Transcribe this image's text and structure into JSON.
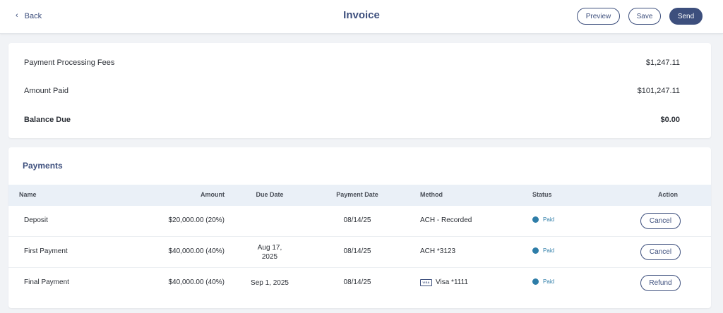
{
  "header": {
    "back_label": "Back",
    "title": "Invoice",
    "preview_label": "Preview",
    "save_label": "Save",
    "send_label": "Send"
  },
  "summary": {
    "rows": [
      {
        "label": "Payment Processing Fees",
        "value": "$1,247.11"
      },
      {
        "label": "Amount Paid",
        "value": "$101,247.11"
      },
      {
        "label": "Balance Due",
        "value": "$0.00"
      }
    ]
  },
  "payments": {
    "title": "Payments",
    "columns": [
      "Name",
      "Amount",
      "Due Date",
      "Payment Date",
      "Method",
      "Status",
      "Action"
    ],
    "rows": [
      {
        "name": "Deposit",
        "amount": "$20,000.00 (20%)",
        "due_date_line1": "",
        "due_date_line2": "",
        "payment_date": "08/14/25",
        "method": "ACH - Recorded",
        "method_icon": "",
        "status": "Paid",
        "action": "Cancel"
      },
      {
        "name": "First Payment",
        "amount": "$40,000.00 (40%)",
        "due_date_line1": "Aug 17,",
        "due_date_line2": "2025",
        "payment_date": "08/14/25",
        "method": "ACH *3123",
        "method_icon": "",
        "status": "Paid",
        "action": "Cancel"
      },
      {
        "name": "Final Payment",
        "amount": "$40,000.00 (40%)",
        "due_date_line1": "Sep 1, 2025",
        "due_date_line2": "",
        "payment_date": "08/14/25",
        "method": "Visa *1111",
        "method_icon": "VISA",
        "status": "Paid",
        "action": "Refund"
      }
    ]
  },
  "colors": {
    "accent": "#3d4f7d",
    "status_paid": "#2e7da8",
    "table_header_bg": "#eaf0f7"
  }
}
